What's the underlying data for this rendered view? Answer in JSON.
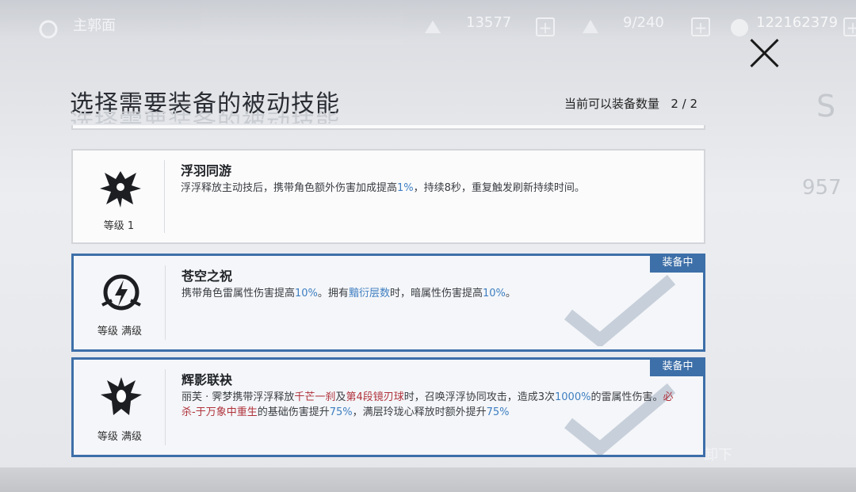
{
  "hud": {
    "left_label": "主郭面",
    "stamina": "13577",
    "capacity": "9/240",
    "currency": "122162379",
    "ghost_rank": "S",
    "ghost_number": "957",
    "ghost_button": "卸下"
  },
  "dialog": {
    "title": "选择需要装备的被动技能",
    "count_label": "当前可以装备数量",
    "count_value": "2 / 2"
  },
  "skills": [
    {
      "name": "浮羽同游",
      "level": "等级 1",
      "equipped": false,
      "desc_parts": [
        "浮浮释放主动技后，携带角色额外伤害加成提高",
        "1%",
        "，持续8秒，重复触发刷新持续时间。"
      ]
    },
    {
      "name": "苍空之祝",
      "level": "等级 满级",
      "equipped": true,
      "badge": "装备中",
      "desc_parts": [
        "携带角色雷属性伤害提高",
        "10%",
        "。拥有",
        "黯衍层数",
        "时，暗属性伤害提高",
        "10%",
        "。"
      ]
    },
    {
      "name": "辉影联袂",
      "level": "等级 满级",
      "equipped": true,
      "badge": "装备中",
      "desc_parts": [
        "丽芙 · 霁梦携带浮浮释放",
        "千芒一刹",
        "及",
        "第4段镜刃球",
        "时，召唤浮浮协同攻击，造成3次",
        "1000%",
        "的雷属性伤害。",
        "必杀-于万象中重生",
        "的基础伤害提升",
        "75%",
        "，满层玲珑心释放时额外提升",
        "75%"
      ]
    }
  ],
  "colors": {
    "accent": "#3d6fa8",
    "highlight_blue": "#3f7fc1",
    "highlight_red": "#b0323b"
  },
  "icons": [
    "close-icon",
    "winged-creature-icon",
    "lightning-emblem-icon",
    "crested-beast-icon",
    "checkmark-icon"
  ]
}
